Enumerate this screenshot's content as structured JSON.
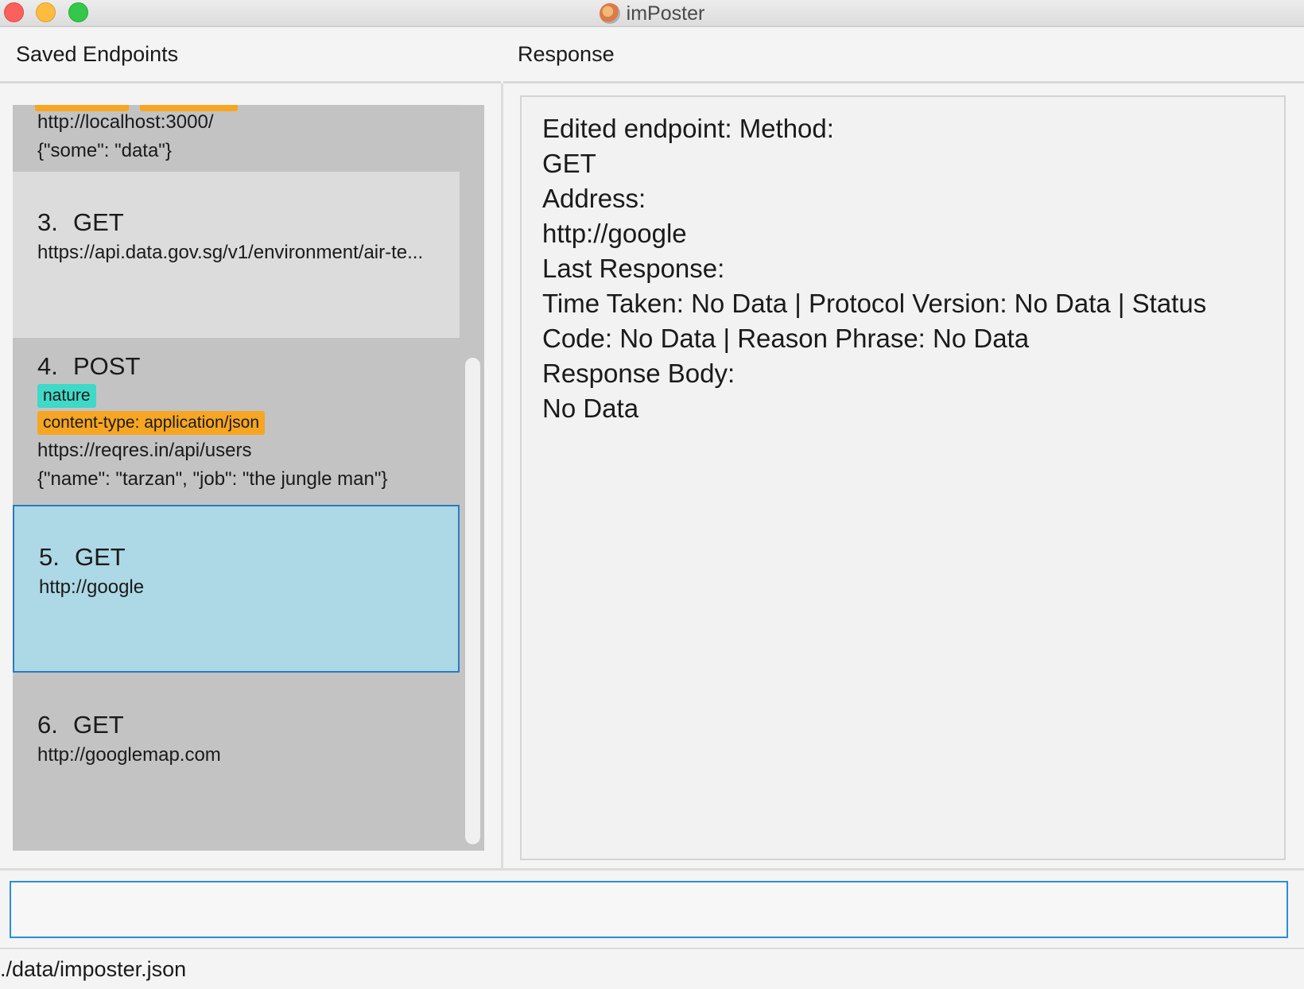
{
  "window": {
    "title": "imPoster"
  },
  "headers": {
    "left": "Saved Endpoints",
    "right": "Response"
  },
  "endpoints": [
    {
      "partial": true,
      "address": "http://localhost:3000/",
      "body": "{\"some\": \"data\"}"
    },
    {
      "index": "3.",
      "method": "GET",
      "address": "https://api.data.gov.sg/v1/environment/air-te..."
    },
    {
      "index": "4.",
      "method": "POST",
      "tags": [
        "nature"
      ],
      "headers": [
        "content-type: application/json"
      ],
      "address": "https://reqres.in/api/users",
      "body": "{\"name\": \"tarzan\", \"job\": \"the jungle man\"}"
    },
    {
      "index": "5.",
      "method": "GET",
      "address": "http://google",
      "selected": true
    },
    {
      "index": "6.",
      "method": "GET",
      "address": "http://googlemap.com"
    }
  ],
  "response": {
    "lines": [
      "Edited endpoint: Method:",
      "GET",
      "Address:",
      "http://google",
      "Last Response:",
      "Time Taken: No Data | Protocol Version: No Data | Status",
      "Code: No Data | Reason Phrase: No Data",
      "Response Body:",
      "No Data"
    ]
  },
  "command_box": {
    "value": ""
  },
  "status_bar": {
    "path": "./data/imposter.json"
  },
  "colors": {
    "tag_orange": "#f6a623",
    "tag_teal": "#40d9c8",
    "selected_bg": "#add8e6",
    "selected_border": "#2a7bbf"
  }
}
